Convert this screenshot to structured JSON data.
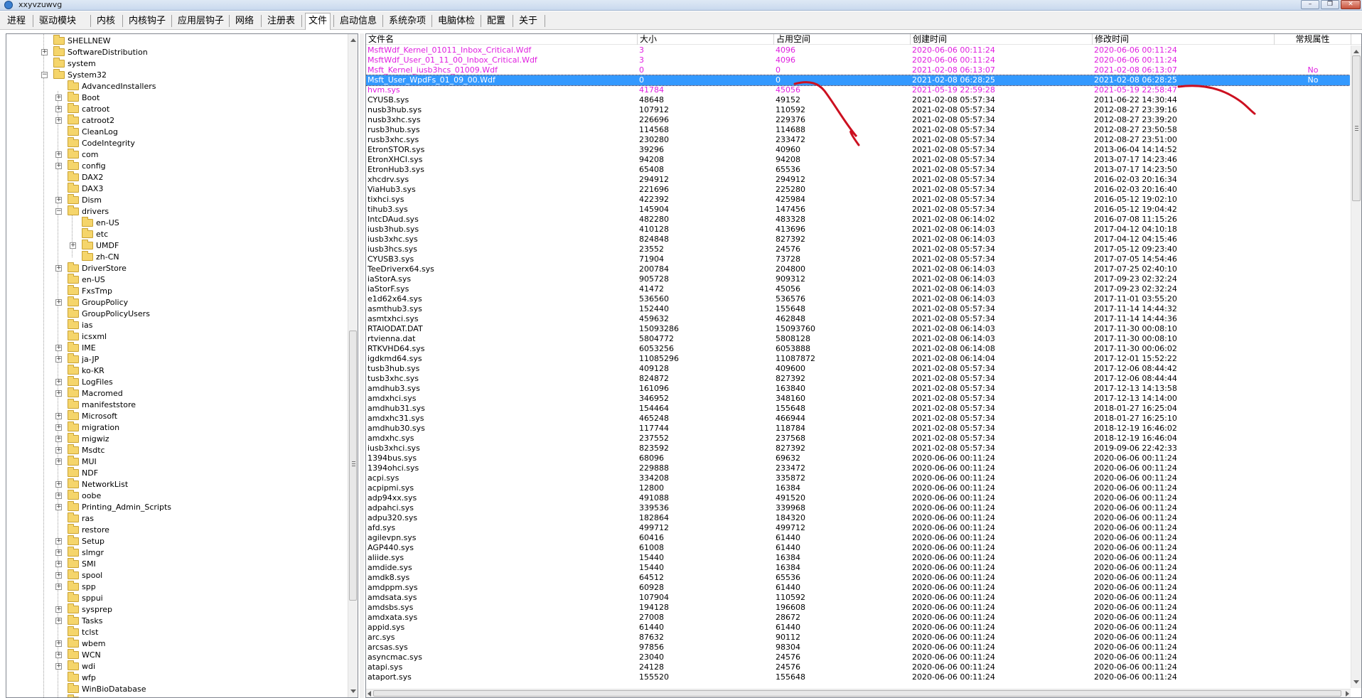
{
  "window": {
    "title": "xxyvzuwvg"
  },
  "colors": {
    "highlight": "#e020e0",
    "selected_bg": "#3399ff",
    "annotation": "#cc1020"
  },
  "menu": [
    "进程",
    "驱动模块",
    "内核",
    "内核钩子",
    "应用层钩子",
    "网络",
    "注册表",
    "文件",
    "启动信息",
    "系统杂项",
    "电脑体检",
    "配置",
    "关于"
  ],
  "active_menu": "文件",
  "tree": [
    {
      "label": "SHELLNEW",
      "level": 1,
      "exp": "",
      "open": false
    },
    {
      "label": "SoftwareDistribution",
      "level": 1,
      "exp": "+",
      "open": false
    },
    {
      "label": "system",
      "level": 1,
      "exp": "",
      "open": false
    },
    {
      "label": "System32",
      "level": 1,
      "exp": "-",
      "open": true
    },
    {
      "label": "AdvancedInstallers",
      "level": 2,
      "exp": "",
      "open": false
    },
    {
      "label": "Boot",
      "level": 2,
      "exp": "+",
      "open": false
    },
    {
      "label": "catroot",
      "level": 2,
      "exp": "+",
      "open": false
    },
    {
      "label": "catroot2",
      "level": 2,
      "exp": "+",
      "open": false
    },
    {
      "label": "CleanLog",
      "level": 2,
      "exp": "",
      "open": false
    },
    {
      "label": "CodeIntegrity",
      "level": 2,
      "exp": "",
      "open": false
    },
    {
      "label": "com",
      "level": 2,
      "exp": "+",
      "open": false
    },
    {
      "label": "config",
      "level": 2,
      "exp": "+",
      "open": false
    },
    {
      "label": "DAX2",
      "level": 2,
      "exp": "",
      "open": false
    },
    {
      "label": "DAX3",
      "level": 2,
      "exp": "",
      "open": false
    },
    {
      "label": "Dism",
      "level": 2,
      "exp": "+",
      "open": false
    },
    {
      "label": "drivers",
      "level": 2,
      "exp": "-",
      "open": true
    },
    {
      "label": "en-US",
      "level": 3,
      "exp": "",
      "open": false
    },
    {
      "label": "etc",
      "level": 3,
      "exp": "",
      "open": false
    },
    {
      "label": "UMDF",
      "level": 3,
      "exp": "+",
      "open": false
    },
    {
      "label": "zh-CN",
      "level": 3,
      "exp": "",
      "open": false
    },
    {
      "label": "DriverStore",
      "level": 2,
      "exp": "+",
      "open": false
    },
    {
      "label": "en-US",
      "level": 2,
      "exp": "",
      "open": false
    },
    {
      "label": "FxsTmp",
      "level": 2,
      "exp": "",
      "open": false
    },
    {
      "label": "GroupPolicy",
      "level": 2,
      "exp": "+",
      "open": false
    },
    {
      "label": "GroupPolicyUsers",
      "level": 2,
      "exp": "",
      "open": false
    },
    {
      "label": "ias",
      "level": 2,
      "exp": "",
      "open": false
    },
    {
      "label": "icsxml",
      "level": 2,
      "exp": "",
      "open": false
    },
    {
      "label": "IME",
      "level": 2,
      "exp": "+",
      "open": false
    },
    {
      "label": "ja-JP",
      "level": 2,
      "exp": "+",
      "open": false
    },
    {
      "label": "ko-KR",
      "level": 2,
      "exp": "",
      "open": false
    },
    {
      "label": "LogFiles",
      "level": 2,
      "exp": "+",
      "open": false
    },
    {
      "label": "Macromed",
      "level": 2,
      "exp": "+",
      "open": false
    },
    {
      "label": "manifeststore",
      "level": 2,
      "exp": "",
      "open": false
    },
    {
      "label": "Microsoft",
      "level": 2,
      "exp": "+",
      "open": false
    },
    {
      "label": "migration",
      "level": 2,
      "exp": "+",
      "open": false
    },
    {
      "label": "migwiz",
      "level": 2,
      "exp": "+",
      "open": false
    },
    {
      "label": "Msdtc",
      "level": 2,
      "exp": "+",
      "open": false
    },
    {
      "label": "MUI",
      "level": 2,
      "exp": "+",
      "open": false
    },
    {
      "label": "NDF",
      "level": 2,
      "exp": "",
      "open": false
    },
    {
      "label": "NetworkList",
      "level": 2,
      "exp": "+",
      "open": false
    },
    {
      "label": "oobe",
      "level": 2,
      "exp": "+",
      "open": false
    },
    {
      "label": "Printing_Admin_Scripts",
      "level": 2,
      "exp": "+",
      "open": false
    },
    {
      "label": "ras",
      "level": 2,
      "exp": "",
      "open": false
    },
    {
      "label": "restore",
      "level": 2,
      "exp": "",
      "open": false
    },
    {
      "label": "Setup",
      "level": 2,
      "exp": "+",
      "open": false
    },
    {
      "label": "slmgr",
      "level": 2,
      "exp": "+",
      "open": false
    },
    {
      "label": "SMI",
      "level": 2,
      "exp": "+",
      "open": false
    },
    {
      "label": "spool",
      "level": 2,
      "exp": "+",
      "open": false
    },
    {
      "label": "spp",
      "level": 2,
      "exp": "+",
      "open": false
    },
    {
      "label": "sppui",
      "level": 2,
      "exp": "",
      "open": false
    },
    {
      "label": "sysprep",
      "level": 2,
      "exp": "+",
      "open": false
    },
    {
      "label": "Tasks",
      "level": 2,
      "exp": "+",
      "open": false
    },
    {
      "label": "tclst",
      "level": 2,
      "exp": "",
      "open": false
    },
    {
      "label": "wbem",
      "level": 2,
      "exp": "+",
      "open": false
    },
    {
      "label": "WCN",
      "level": 2,
      "exp": "+",
      "open": false
    },
    {
      "label": "wdi",
      "level": 2,
      "exp": "+",
      "open": false
    },
    {
      "label": "wfp",
      "level": 2,
      "exp": "",
      "open": false
    },
    {
      "label": "WinBioDatabase",
      "level": 2,
      "exp": "",
      "open": false
    },
    {
      "label": "WinBioPlugIns",
      "level": 2,
      "exp": "+",
      "open": false
    }
  ],
  "columns": [
    "文件名",
    "大小",
    "占用空间",
    "创建时间",
    "修改时间",
    "常规属性"
  ],
  "files": [
    {
      "name": "MsftWdf_Kernel_01011_Inbox_Critical.Wdf",
      "size": "3",
      "alloc": "4096",
      "created": "2020-06-06 00:11:24",
      "modified": "2020-06-06 00:11:24",
      "attr": "",
      "style": "pink"
    },
    {
      "name": "MsftWdf_User_01_11_00_Inbox_Critical.Wdf",
      "size": "3",
      "alloc": "4096",
      "created": "2020-06-06 00:11:24",
      "modified": "2020-06-06 00:11:24",
      "attr": "",
      "style": "pink"
    },
    {
      "name": "Msft_Kernel_iusb3hcs_01009.Wdf",
      "size": "0",
      "alloc": "0",
      "created": "2021-02-08 06:13:07",
      "modified": "2021-02-08 06:13:07",
      "attr": "No",
      "style": "pink"
    },
    {
      "name": "Msft_User_WpdFs_01_09_00.Wdf",
      "size": "0",
      "alloc": "0",
      "created": "2021-02-08 06:28:25",
      "modified": "2021-02-08 06:28:25",
      "attr": "No",
      "style": "sel"
    },
    {
      "name": "hvm.sys",
      "size": "41784",
      "alloc": "45056",
      "created": "2021-05-19 22:59:28",
      "modified": "2021-05-19 22:58:47",
      "attr": "",
      "style": "pink"
    },
    {
      "name": "CYUSB.sys",
      "size": "48648",
      "alloc": "49152",
      "created": "2021-02-08 05:57:34",
      "modified": "2011-06-22 14:30:44",
      "attr": "",
      "style": ""
    },
    {
      "name": "nusb3hub.sys",
      "size": "107912",
      "alloc": "110592",
      "created": "2021-02-08 05:57:34",
      "modified": "2012-08-27 23:39:16",
      "attr": "",
      "style": ""
    },
    {
      "name": "nusb3xhc.sys",
      "size": "226696",
      "alloc": "229376",
      "created": "2021-02-08 05:57:34",
      "modified": "2012-08-27 23:39:20",
      "attr": "",
      "style": ""
    },
    {
      "name": "rusb3hub.sys",
      "size": "114568",
      "alloc": "114688",
      "created": "2021-02-08 05:57:34",
      "modified": "2012-08-27 23:50:58",
      "attr": "",
      "style": ""
    },
    {
      "name": "rusb3xhc.sys",
      "size": "230280",
      "alloc": "233472",
      "created": "2021-02-08 05:57:34",
      "modified": "2012-08-27 23:51:00",
      "attr": "",
      "style": ""
    },
    {
      "name": "EtronSTOR.sys",
      "size": "39296",
      "alloc": "40960",
      "created": "2021-02-08 05:57:34",
      "modified": "2013-06-04 14:14:52",
      "attr": "",
      "style": ""
    },
    {
      "name": "EtronXHCI.sys",
      "size": "94208",
      "alloc": "94208",
      "created": "2021-02-08 05:57:34",
      "modified": "2013-07-17 14:23:46",
      "attr": "",
      "style": ""
    },
    {
      "name": "EtronHub3.sys",
      "size": "65408",
      "alloc": "65536",
      "created": "2021-02-08 05:57:34",
      "modified": "2013-07-17 14:23:50",
      "attr": "",
      "style": ""
    },
    {
      "name": "xhcdrv.sys",
      "size": "294912",
      "alloc": "294912",
      "created": "2021-02-08 05:57:34",
      "modified": "2016-02-03 20:16:34",
      "attr": "",
      "style": ""
    },
    {
      "name": "ViaHub3.sys",
      "size": "221696",
      "alloc": "225280",
      "created": "2021-02-08 05:57:34",
      "modified": "2016-02-03 20:16:40",
      "attr": "",
      "style": ""
    },
    {
      "name": "tixhci.sys",
      "size": "422392",
      "alloc": "425984",
      "created": "2021-02-08 05:57:34",
      "modified": "2016-05-12 19:02:10",
      "attr": "",
      "style": ""
    },
    {
      "name": "tihub3.sys",
      "size": "145904",
      "alloc": "147456",
      "created": "2021-02-08 05:57:34",
      "modified": "2016-05-12 19:04:42",
      "attr": "",
      "style": ""
    },
    {
      "name": "IntcDAud.sys",
      "size": "482280",
      "alloc": "483328",
      "created": "2021-02-08 06:14:02",
      "modified": "2016-07-08 11:15:26",
      "attr": "",
      "style": ""
    },
    {
      "name": "iusb3hub.sys",
      "size": "410128",
      "alloc": "413696",
      "created": "2021-02-08 06:14:03",
      "modified": "2017-04-12 04:10:18",
      "attr": "",
      "style": ""
    },
    {
      "name": "iusb3xhc.sys",
      "size": "824848",
      "alloc": "827392",
      "created": "2021-02-08 06:14:03",
      "modified": "2017-04-12 04:15:46",
      "attr": "",
      "style": ""
    },
    {
      "name": "iusb3hcs.sys",
      "size": "23552",
      "alloc": "24576",
      "created": "2021-02-08 05:57:34",
      "modified": "2017-05-12 09:23:40",
      "attr": "",
      "style": ""
    },
    {
      "name": "CYUSB3.sys",
      "size": "71904",
      "alloc": "73728",
      "created": "2021-02-08 05:57:34",
      "modified": "2017-07-05 14:54:46",
      "attr": "",
      "style": ""
    },
    {
      "name": "TeeDriverx64.sys",
      "size": "200784",
      "alloc": "204800",
      "created": "2021-02-08 06:14:03",
      "modified": "2017-07-25 02:40:10",
      "attr": "",
      "style": ""
    },
    {
      "name": "iaStorA.sys",
      "size": "905728",
      "alloc": "909312",
      "created": "2021-02-08 06:14:03",
      "modified": "2017-09-23 02:32:24",
      "attr": "",
      "style": ""
    },
    {
      "name": "iaStorF.sys",
      "size": "41472",
      "alloc": "45056",
      "created": "2021-02-08 06:14:03",
      "modified": "2017-09-23 02:32:24",
      "attr": "",
      "style": ""
    },
    {
      "name": "e1d62x64.sys",
      "size": "536560",
      "alloc": "536576",
      "created": "2021-02-08 06:14:03",
      "modified": "2017-11-01 03:55:20",
      "attr": "",
      "style": ""
    },
    {
      "name": "asmthub3.sys",
      "size": "152440",
      "alloc": "155648",
      "created": "2021-02-08 05:57:34",
      "modified": "2017-11-14 14:44:32",
      "attr": "",
      "style": ""
    },
    {
      "name": "asmtxhci.sys",
      "size": "459632",
      "alloc": "462848",
      "created": "2021-02-08 05:57:34",
      "modified": "2017-11-14 14:44:36",
      "attr": "",
      "style": ""
    },
    {
      "name": "RTAIODAT.DAT",
      "size": "15093286",
      "alloc": "15093760",
      "created": "2021-02-08 06:14:03",
      "modified": "2017-11-30 00:08:10",
      "attr": "",
      "style": ""
    },
    {
      "name": "rtvienna.dat",
      "size": "5804772",
      "alloc": "5808128",
      "created": "2021-02-08 06:14:03",
      "modified": "2017-11-30 00:08:10",
      "attr": "",
      "style": ""
    },
    {
      "name": "RTKVHD64.sys",
      "size": "6053256",
      "alloc": "6053888",
      "created": "2021-02-08 06:14:08",
      "modified": "2017-11-30 00:06:02",
      "attr": "",
      "style": ""
    },
    {
      "name": "igdkmd64.sys",
      "size": "11085296",
      "alloc": "11087872",
      "created": "2021-02-08 06:14:04",
      "modified": "2017-12-01 15:52:22",
      "attr": "",
      "style": ""
    },
    {
      "name": "tusb3hub.sys",
      "size": "409128",
      "alloc": "409600",
      "created": "2021-02-08 05:57:34",
      "modified": "2017-12-06 08:44:42",
      "attr": "",
      "style": ""
    },
    {
      "name": "tusb3xhc.sys",
      "size": "824872",
      "alloc": "827392",
      "created": "2021-02-08 05:57:34",
      "modified": "2017-12-06 08:44:44",
      "attr": "",
      "style": ""
    },
    {
      "name": "amdhub3.sys",
      "size": "161096",
      "alloc": "163840",
      "created": "2021-02-08 05:57:34",
      "modified": "2017-12-13 14:13:58",
      "attr": "",
      "style": ""
    },
    {
      "name": "amdxhci.sys",
      "size": "346952",
      "alloc": "348160",
      "created": "2021-02-08 05:57:34",
      "modified": "2017-12-13 14:14:00",
      "attr": "",
      "style": ""
    },
    {
      "name": "amdhub31.sys",
      "size": "154464",
      "alloc": "155648",
      "created": "2021-02-08 05:57:34",
      "modified": "2018-01-27 16:25:04",
      "attr": "",
      "style": ""
    },
    {
      "name": "amdxhc31.sys",
      "size": "465248",
      "alloc": "466944",
      "created": "2021-02-08 05:57:34",
      "modified": "2018-01-27 16:25:10",
      "attr": "",
      "style": ""
    },
    {
      "name": "amdhub30.sys",
      "size": "117744",
      "alloc": "118784",
      "created": "2021-02-08 05:57:34",
      "modified": "2018-12-19 16:46:02",
      "attr": "",
      "style": ""
    },
    {
      "name": "amdxhc.sys",
      "size": "237552",
      "alloc": "237568",
      "created": "2021-02-08 05:57:34",
      "modified": "2018-12-19 16:46:04",
      "attr": "",
      "style": ""
    },
    {
      "name": "iusb3xhci.sys",
      "size": "823592",
      "alloc": "827392",
      "created": "2021-02-08 05:57:34",
      "modified": "2019-09-06 22:42:33",
      "attr": "",
      "style": ""
    },
    {
      "name": "1394bus.sys",
      "size": "68096",
      "alloc": "69632",
      "created": "2020-06-06 00:11:24",
      "modified": "2020-06-06 00:11:24",
      "attr": "",
      "style": ""
    },
    {
      "name": "1394ohci.sys",
      "size": "229888",
      "alloc": "233472",
      "created": "2020-06-06 00:11:24",
      "modified": "2020-06-06 00:11:24",
      "attr": "",
      "style": ""
    },
    {
      "name": "acpi.sys",
      "size": "334208",
      "alloc": "335872",
      "created": "2020-06-06 00:11:24",
      "modified": "2020-06-06 00:11:24",
      "attr": "",
      "style": ""
    },
    {
      "name": "acpipmi.sys",
      "size": "12800",
      "alloc": "16384",
      "created": "2020-06-06 00:11:24",
      "modified": "2020-06-06 00:11:24",
      "attr": "",
      "style": ""
    },
    {
      "name": "adp94xx.sys",
      "size": "491088",
      "alloc": "491520",
      "created": "2020-06-06 00:11:24",
      "modified": "2020-06-06 00:11:24",
      "attr": "",
      "style": ""
    },
    {
      "name": "adpahci.sys",
      "size": "339536",
      "alloc": "339968",
      "created": "2020-06-06 00:11:24",
      "modified": "2020-06-06 00:11:24",
      "attr": "",
      "style": ""
    },
    {
      "name": "adpu320.sys",
      "size": "182864",
      "alloc": "184320",
      "created": "2020-06-06 00:11:24",
      "modified": "2020-06-06 00:11:24",
      "attr": "",
      "style": ""
    },
    {
      "name": "afd.sys",
      "size": "499712",
      "alloc": "499712",
      "created": "2020-06-06 00:11:24",
      "modified": "2020-06-06 00:11:24",
      "attr": "",
      "style": ""
    },
    {
      "name": "agilevpn.sys",
      "size": "60416",
      "alloc": "61440",
      "created": "2020-06-06 00:11:24",
      "modified": "2020-06-06 00:11:24",
      "attr": "",
      "style": ""
    },
    {
      "name": "AGP440.sys",
      "size": "61008",
      "alloc": "61440",
      "created": "2020-06-06 00:11:24",
      "modified": "2020-06-06 00:11:24",
      "attr": "",
      "style": ""
    },
    {
      "name": "aliide.sys",
      "size": "15440",
      "alloc": "16384",
      "created": "2020-06-06 00:11:24",
      "modified": "2020-06-06 00:11:24",
      "attr": "",
      "style": ""
    },
    {
      "name": "amdide.sys",
      "size": "15440",
      "alloc": "16384",
      "created": "2020-06-06 00:11:24",
      "modified": "2020-06-06 00:11:24",
      "attr": "",
      "style": ""
    },
    {
      "name": "amdk8.sys",
      "size": "64512",
      "alloc": "65536",
      "created": "2020-06-06 00:11:24",
      "modified": "2020-06-06 00:11:24",
      "attr": "",
      "style": ""
    },
    {
      "name": "amdppm.sys",
      "size": "60928",
      "alloc": "61440",
      "created": "2020-06-06 00:11:24",
      "modified": "2020-06-06 00:11:24",
      "attr": "",
      "style": ""
    },
    {
      "name": "amdsata.sys",
      "size": "107904",
      "alloc": "110592",
      "created": "2020-06-06 00:11:24",
      "modified": "2020-06-06 00:11:24",
      "attr": "",
      "style": ""
    },
    {
      "name": "amdsbs.sys",
      "size": "194128",
      "alloc": "196608",
      "created": "2020-06-06 00:11:24",
      "modified": "2020-06-06 00:11:24",
      "attr": "",
      "style": ""
    },
    {
      "name": "amdxata.sys",
      "size": "27008",
      "alloc": "28672",
      "created": "2020-06-06 00:11:24",
      "modified": "2020-06-06 00:11:24",
      "attr": "",
      "style": ""
    },
    {
      "name": "appid.sys",
      "size": "61440",
      "alloc": "61440",
      "created": "2020-06-06 00:11:24",
      "modified": "2020-06-06 00:11:24",
      "attr": "",
      "style": ""
    },
    {
      "name": "arc.sys",
      "size": "87632",
      "alloc": "90112",
      "created": "2020-06-06 00:11:24",
      "modified": "2020-06-06 00:11:24",
      "attr": "",
      "style": ""
    },
    {
      "name": "arcsas.sys",
      "size": "97856",
      "alloc": "98304",
      "created": "2020-06-06 00:11:24",
      "modified": "2020-06-06 00:11:24",
      "attr": "",
      "style": ""
    },
    {
      "name": "asyncmac.sys",
      "size": "23040",
      "alloc": "24576",
      "created": "2020-06-06 00:11:24",
      "modified": "2020-06-06 00:11:24",
      "attr": "",
      "style": ""
    },
    {
      "name": "atapi.sys",
      "size": "24128",
      "alloc": "24576",
      "created": "2020-06-06 00:11:24",
      "modified": "2020-06-06 00:11:24",
      "attr": "",
      "style": ""
    },
    {
      "name": "ataport.sys",
      "size": "155520",
      "alloc": "155648",
      "created": "2020-06-06 00:11:24",
      "modified": "2020-06-06 00:11:24",
      "attr": "",
      "style": ""
    }
  ]
}
